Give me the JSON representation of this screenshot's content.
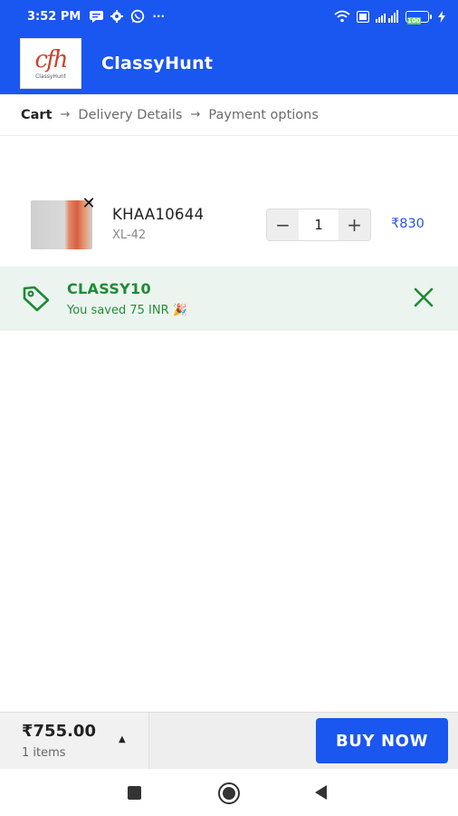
{
  "status_bar": {
    "time": "3:52 PM",
    "left_icons": [
      "message-icon",
      "gear-icon",
      "whatsapp-icon",
      "more-dots-icon"
    ],
    "right_icons": [
      "wifi-icon",
      "vo-icon",
      "signal-icon",
      "battery-icon",
      "charging-icon"
    ],
    "battery_label": "100"
  },
  "header": {
    "logo_mark": "cfh",
    "logo_text": "ClassyHunt",
    "title": "ClassyHunt"
  },
  "breadcrumb": {
    "steps": [
      "Cart",
      "Delivery Details",
      "Payment options"
    ],
    "separator": "→",
    "active_index": 0
  },
  "cart": {
    "item": {
      "code": "KHAA10644",
      "size": "XL-42",
      "quantity": "1",
      "decrement": "−",
      "increment": "+",
      "remove": "✕",
      "price": "₹830"
    }
  },
  "coupon": {
    "code": "CLASSY10",
    "message": "You saved 75 INR 🎉"
  },
  "footer": {
    "total": "₹755.00",
    "items_count": "1 items",
    "caret": "▲",
    "buy_now_label": "BUY NOW"
  },
  "colors": {
    "brand": "#1a56f0",
    "price": "#2a55e0",
    "coupon_green": "#1f8a35",
    "coupon_bg": "#ebf4ef"
  }
}
